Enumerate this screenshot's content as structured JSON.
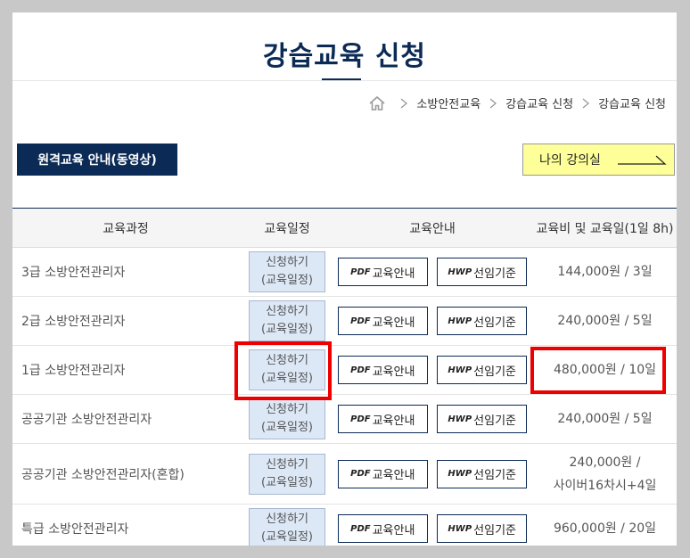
{
  "page": {
    "title": "강습교육 신청"
  },
  "breadcrumb": {
    "home_icon": "home-icon",
    "items": [
      "소방안전교육",
      "강습교육 신청",
      "강습교육 신청"
    ]
  },
  "buttons": {
    "remote_guide": "원격교육 안내(동영상)",
    "my_lecture": "나의 강의실"
  },
  "table": {
    "headers": [
      "교육과정",
      "교육일정",
      "교육안내",
      "교육비 및 교육일(1일 8h)"
    ],
    "schedule_button": {
      "line1": "신청하기",
      "line2": "(교육일정)"
    },
    "guide_button": {
      "tag": "PDF",
      "label": "교육안내"
    },
    "criteria_button": {
      "tag": "HWP",
      "label": "선임기준"
    },
    "rows": [
      {
        "course": "3급 소방안전관리자",
        "fee": "144,000원 / 3일"
      },
      {
        "course": "2급 소방안전관리자",
        "fee": "240,000원 / 5일"
      },
      {
        "course": "1급 소방안전관리자",
        "fee": "480,000원 / 10일"
      },
      {
        "course": "공공기관 소방안전관리자",
        "fee": "240,000원 / 5일"
      },
      {
        "course": "공공기관 소방안전관리자(혼합)",
        "fee_line1": "240,000원 /",
        "fee_line2": "사이버16차시+4일"
      },
      {
        "course": "특급 소방안전관리자",
        "fee": "960,000원 / 20일"
      }
    ]
  },
  "colors": {
    "navy": "#0b2a55",
    "highlight_red": "#ee0000",
    "lecture_yellow": "#ffff99",
    "schedule_blue": "#dde8f7"
  }
}
